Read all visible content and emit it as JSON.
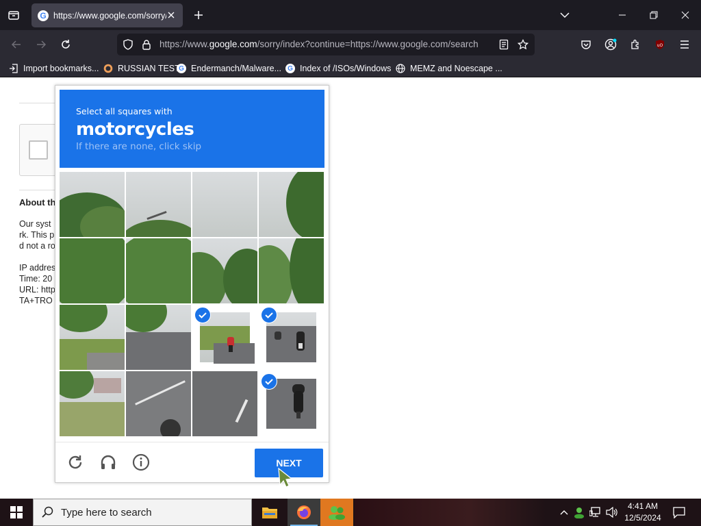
{
  "browser": {
    "tab": {
      "favicon": "G",
      "title": "https://www.google.com/sorry/index?continue=https://www.google.com/search"
    },
    "url": {
      "prefix": "https://www.",
      "domain": "google.com",
      "rest": "/sorry/index?continue=https://www.google.com/search"
    },
    "bookmarks": [
      {
        "label": "Import bookmarks...",
        "icon": "import-icon"
      },
      {
        "label": "RUSSIAN TEST",
        "icon": "github-icon"
      },
      {
        "label": "Endermanch/Malware...",
        "icon": "google-icon"
      },
      {
        "label": "Index of /ISOs/Windows",
        "icon": "google-icon"
      },
      {
        "label": "MEMZ and Noescape ...",
        "icon": "globe-icon"
      }
    ],
    "colors": {
      "tabbar": "#1c1b22",
      "navbar": "#2b2a33",
      "accent": "#1a73e8"
    }
  },
  "page": {
    "about_title": "About th",
    "lines": [
      "Our syst",
      "rk. This p",
      "d not a ro",
      "IP addres",
      "Time: 20",
      "URL: http",
      "TA+TRO"
    ]
  },
  "captcha": {
    "instruction_small": "Select all squares with",
    "target": "motorcycles",
    "hint": "If there are none, click skip",
    "selected_tiles": [
      10,
      11,
      15
    ],
    "next_label": "NEXT",
    "footer_icons": [
      "reload-icon",
      "audio-icon",
      "info-icon"
    ]
  },
  "taskbar": {
    "search_placeholder": "Type here to search",
    "time": "4:41 AM",
    "date": "12/5/2024"
  }
}
